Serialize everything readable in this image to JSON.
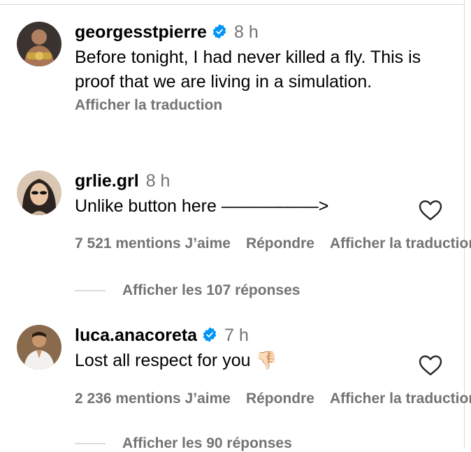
{
  "comments": [
    {
      "username": "georgesstpierre",
      "verified": true,
      "time": "8 h",
      "text": "Before tonight, I had never killed a fly. This is proof that we are living in a simulation.",
      "translate_label": "Afficher la traduction"
    },
    {
      "username": "grlie.grl",
      "verified": false,
      "time": "8 h",
      "text": "Unlike button here ———–——>",
      "likes": "7 521 mentions J’aime",
      "reply_label": "Répondre",
      "translate_label": "Afficher la traduction",
      "view_replies": "Afficher les 107 réponses"
    },
    {
      "username": "luca.anacoreta",
      "verified": true,
      "time": "7 h",
      "text": "Lost all respect for you",
      "emoji": "👎🏻",
      "likes": "2 236 mentions J’aime",
      "reply_label": "Répondre",
      "translate_label": "Afficher la traduction",
      "view_replies": "Afficher les 90 réponses"
    }
  ],
  "colors": {
    "secondary_text": "#737373",
    "verified_blue": "#0095f6",
    "divider": "#dbdbdb"
  }
}
